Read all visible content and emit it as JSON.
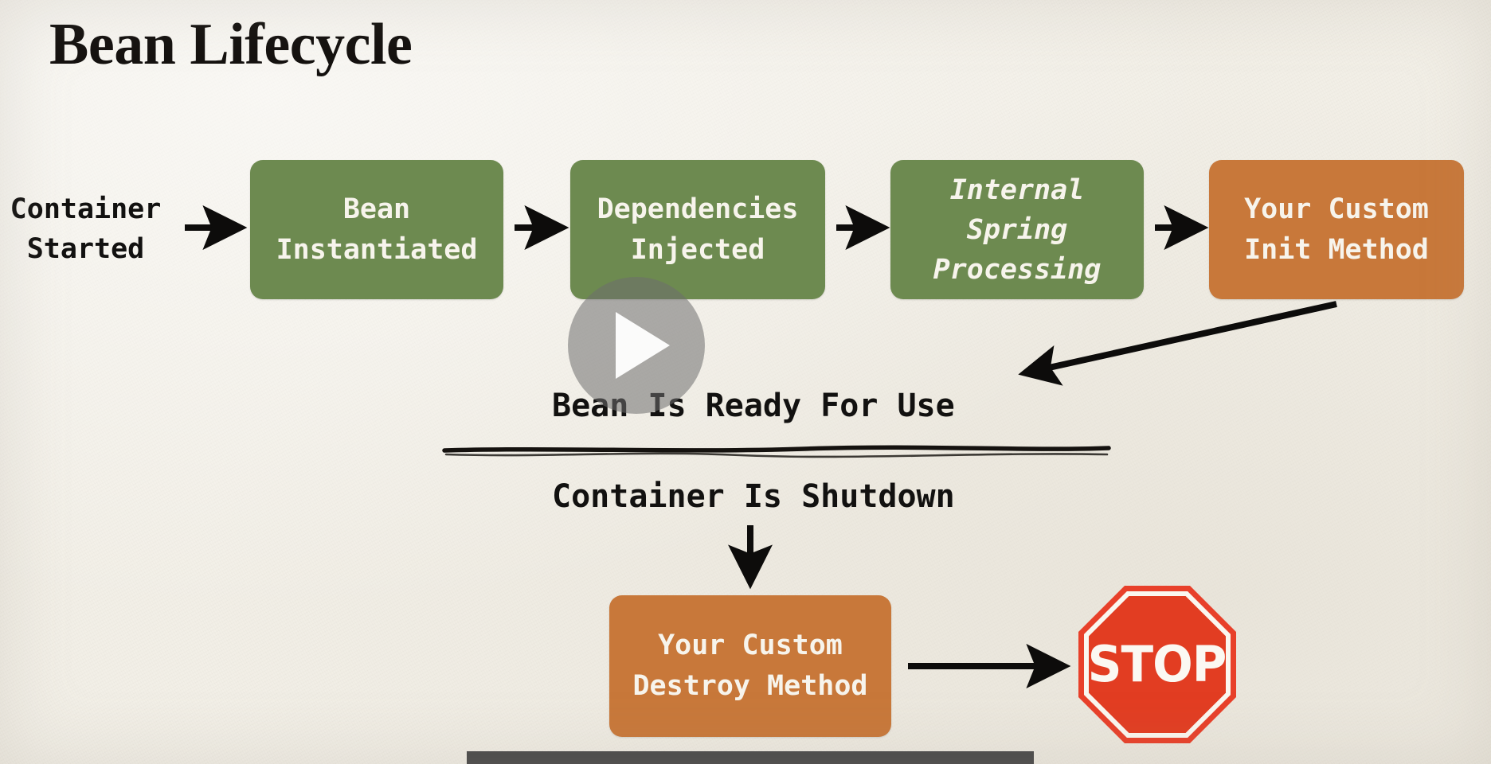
{
  "slide": {
    "title": "Bean Lifecycle",
    "background_color": "#f2efe7",
    "green_color": "#6d8a50",
    "orange_color": "#c8783a",
    "stop_red": "#e23d22",
    "text_color": "#121110"
  },
  "flow": {
    "start_label": "Container\nStarted",
    "nodes": [
      {
        "label": "Bean\nInstantiated",
        "color": "green",
        "style": "normal"
      },
      {
        "label": "Dependencies\nInjected",
        "color": "green",
        "style": "normal"
      },
      {
        "label": "Internal\nSpring\nProcessing",
        "color": "green",
        "style": "italic"
      },
      {
        "label": "Your Custom\nInit Method",
        "color": "orange",
        "style": "normal"
      }
    ]
  },
  "middle": {
    "ready_text": "Bean Is Ready For Use",
    "shutdown_text": "Container Is Shutdown"
  },
  "shutdown": {
    "destroy_label": "Your Custom\nDestroy Method",
    "stop_label": "STOP"
  },
  "player": {
    "play_icon": "play-icon",
    "state": "paused"
  }
}
